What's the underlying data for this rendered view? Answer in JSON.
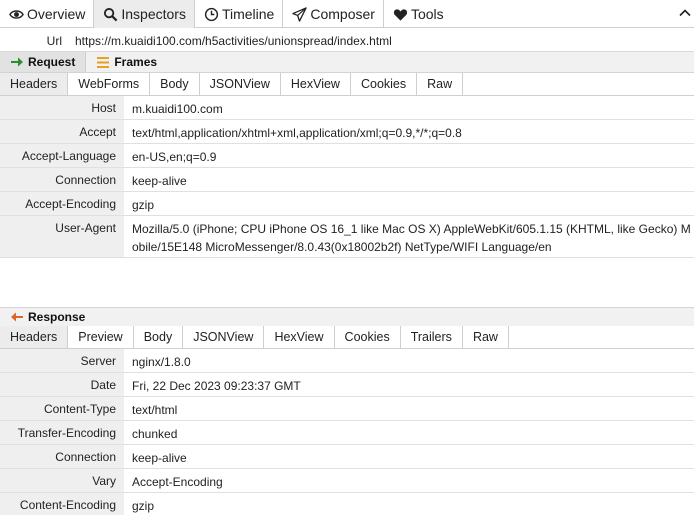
{
  "toptabs": [
    {
      "label": "Overview",
      "icon": "eye-icon"
    },
    {
      "label": "Inspectors",
      "icon": "search-icon"
    },
    {
      "label": "Timeline",
      "icon": "clock-icon"
    },
    {
      "label": "Composer",
      "icon": "send-icon"
    },
    {
      "label": "Tools",
      "icon": "heart-icon"
    }
  ],
  "url": {
    "label": "Url",
    "value": "https://m.kuaidi100.com/h5activities/unionspread/index.html"
  },
  "request": {
    "tab_label": "Request",
    "frames_label": "Frames",
    "inspector_tabs": [
      "Headers",
      "WebForms",
      "Body",
      "JSONView",
      "HexView",
      "Cookies",
      "Raw"
    ],
    "headers": [
      {
        "name": "Host",
        "value": "m.kuaidi100.com"
      },
      {
        "name": "Accept",
        "value": "text/html,application/xhtml+xml,application/xml;q=0.9,*/*;q=0.8"
      },
      {
        "name": "Accept-Language",
        "value": "en-US,en;q=0.9"
      },
      {
        "name": "Connection",
        "value": "keep-alive"
      },
      {
        "name": "Accept-Encoding",
        "value": "gzip"
      },
      {
        "name": "User-Agent",
        "value": "Mozilla/5.0 (iPhone; CPU iPhone OS 16_1 like Mac OS X) AppleWebKit/605.1.15 (KHTML, like Gecko) Mobile/15E148 MicroMessenger/8.0.43(0x18002b2f) NetType/WIFI Language/en"
      }
    ]
  },
  "response": {
    "tab_label": "Response",
    "inspector_tabs": [
      "Headers",
      "Preview",
      "Body",
      "JSONView",
      "HexView",
      "Cookies",
      "Trailers",
      "Raw"
    ],
    "headers": [
      {
        "name": "Server",
        "value": "nginx/1.8.0"
      },
      {
        "name": "Date",
        "value": "Fri, 22 Dec 2023 09:23:37 GMT"
      },
      {
        "name": "Content-Type",
        "value": "text/html"
      },
      {
        "name": "Transfer-Encoding",
        "value": "chunked"
      },
      {
        "name": "Connection",
        "value": "keep-alive"
      },
      {
        "name": "Vary",
        "value": "Accept-Encoding"
      },
      {
        "name": "Content-Encoding",
        "value": "gzip"
      }
    ]
  },
  "colors": {
    "request_arrow": "#2e8b2e",
    "response_arrow": "#e0642a",
    "frames_icon": "#e8a020"
  }
}
